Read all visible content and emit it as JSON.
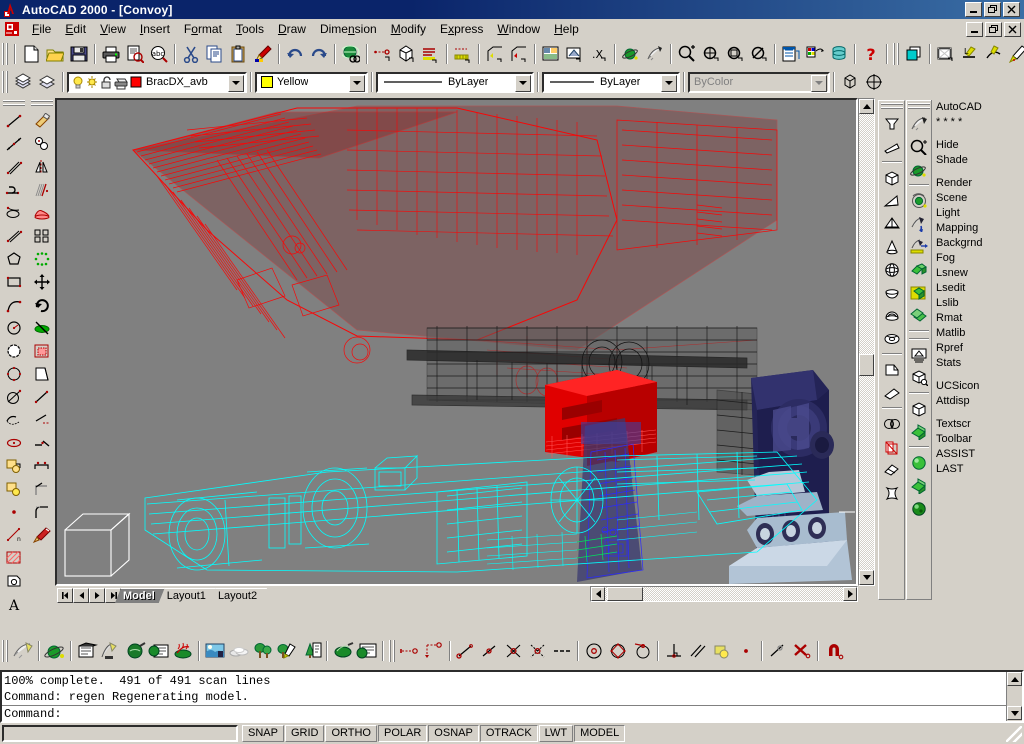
{
  "window": {
    "title": "AutoCAD 2000 - [Convoy]",
    "app_icon": "autocad-icon",
    "minimize": "_",
    "maximize": "❐",
    "close": "✕"
  },
  "menubar": {
    "doc_icon": "document-control-icon",
    "items": [
      {
        "label": "File",
        "accel": "F"
      },
      {
        "label": "Edit",
        "accel": "E"
      },
      {
        "label": "View",
        "accel": "V"
      },
      {
        "label": "Insert",
        "accel": "I"
      },
      {
        "label": "Format",
        "accel": "o"
      },
      {
        "label": "Tools",
        "accel": "T"
      },
      {
        "label": "Draw",
        "accel": "D"
      },
      {
        "label": "Dimension",
        "accel": "n"
      },
      {
        "label": "Modify",
        "accel": "M"
      },
      {
        "label": "Express",
        "accel": "x"
      },
      {
        "label": "Window",
        "accel": "W"
      },
      {
        "label": "Help",
        "accel": "H"
      }
    ],
    "doc_minimize": "_",
    "doc_restore": "❐",
    "doc_close": "✕"
  },
  "standard_toolbar": {
    "buttons": [
      "new-icon",
      "open-icon",
      "save-icon",
      "print-icon",
      "print-preview-icon",
      "find-replace-icon",
      "cut-icon",
      "copy-icon",
      "paste-icon",
      "match-properties-icon",
      "undo-icon",
      "redo-icon",
      "launch-browser-icon",
      "dist-icon",
      "block-icon",
      "list-icon",
      "measure-icon",
      "ucs-icon",
      "ucs-previous-icon",
      "named-views-icon",
      "3d-views-icon",
      "unnamed-icon",
      "shade-icon",
      "render-icon",
      "zoom-realtime-icon",
      "pan-realtime-icon",
      "zoom-window-icon",
      "zoom-previous-icon",
      "properties-icon",
      "designcenter-icon",
      "dbconnect-icon",
      "help-icon"
    ]
  },
  "express_toolbar": {
    "buttons": [
      "color-swatch-icon",
      "layer-manager-icon",
      "text-fit-icon",
      "arc-aligned-text-icon",
      "explode-text-icon",
      "text-mask-icon",
      "rtext-icon"
    ]
  },
  "properties_toolbar": {
    "make_object_layer_icon": "make-object-layer-icon",
    "layer_previous_icon": "layer-previous-icon",
    "layer": {
      "value": "BracDX_avb",
      "icons": [
        "lightbulb-on-icon",
        "freeze-sun-icon",
        "unlock-icon",
        "plot-icon",
        "color-swatch-red-icon"
      ]
    },
    "color": {
      "value": "Yellow",
      "swatch": "#ffff00"
    },
    "linetype": {
      "value": "ByLayer"
    },
    "lineweight": {
      "value": "ByLayer"
    },
    "plotstyle": {
      "value": "ByColor",
      "disabled": true
    },
    "extra_buttons": [
      "inquiry-icon",
      "ucs-target-icon"
    ]
  },
  "draw_toolbar": {
    "name": "Draw",
    "buttons": [
      "line-icon",
      "construction-line-icon",
      "multiline-icon",
      "polyline-icon",
      "polygon-icon",
      "rectangle-icon",
      "arc-icon",
      "circle-icon",
      "revision-cloud-icon",
      "spline-icon",
      "ellipse-icon",
      "ellipse-arc-icon",
      "insert-block-icon",
      "make-block-icon",
      "point-icon",
      "hatch-icon",
      "region-icon",
      "multiline-text-icon"
    ]
  },
  "modify_toolbar": {
    "name": "Modify",
    "buttons": [
      "erase-icon",
      "copy-object-icon",
      "mirror-icon",
      "offset-icon",
      "array-icon",
      "move-icon",
      "rotate-icon",
      "scale-icon",
      "stretch-icon",
      "lengthen-icon",
      "trim-icon",
      "extend-icon",
      "break-at-point-icon",
      "break-icon",
      "chamfer-icon",
      "fillet-icon",
      "explode-icon"
    ]
  },
  "solids_toolbar": {
    "name": "Solids",
    "buttons": [
      "polysolid-icon",
      "wedge-icon",
      "box-icon",
      "cone-pyramid-icon",
      "pyramid-icon",
      "cone-icon",
      "sphere-icon",
      "dish-icon",
      "dome-icon",
      "torus-icon",
      "extrude-icon",
      "revolve-icon",
      "slice-icon",
      "section-icon",
      "interfere-icon",
      "setup-drawing-icon"
    ]
  },
  "render_toolbar": {
    "name": "Render",
    "buttons": [
      "hide-icon",
      "zoom-icon",
      "shade-icon",
      "render-icon",
      "scene-icon",
      "light-icon",
      "materials-icon",
      "materials-library-icon",
      "mapping-icon",
      "render-preferences-icon",
      "statistics-icon",
      "landscape-new-icon",
      "landscape-edit-icon",
      "landscape-library-icon",
      "fog-icon"
    ]
  },
  "screen_menu": {
    "groups": [
      [
        "AutoCAD",
        "* * * *"
      ],
      [
        "Hide",
        "Shade"
      ],
      [
        "Render",
        "Scene",
        "Light",
        "Mapping",
        "Backgrnd",
        "Fog",
        "Lsnew",
        "Lsedit",
        "Lslib",
        "Rmat",
        "Matlib",
        "Rpref",
        "Stats"
      ],
      [
        "UCSicon",
        "Attdisp"
      ],
      [
        "Textscr",
        "Toolbar",
        "ASSIST",
        "LAST"
      ]
    ]
  },
  "render_bottom_toolbar": {
    "buttons": [
      "hide-icon",
      "shade-icon",
      "render-icon",
      "scene-icon",
      "light-icon",
      "materials-icon",
      "materials-library-icon",
      "mapping-icon",
      "background-icon",
      "fog-icon",
      "landscape-new-icon",
      "landscape-edit-icon",
      "landscape-library-icon",
      "render-preferences-icon",
      "statistics-icon"
    ]
  },
  "osnap_toolbar": {
    "buttons": [
      "snap-from-icon",
      "snap-tracking-icon",
      "snap-endpoint-icon",
      "snap-midpoint-icon",
      "snap-intersection-icon",
      "snap-apparent-intersection-icon",
      "snap-extension-icon",
      "snap-center-icon",
      "snap-quadrant-icon",
      "snap-tangent-icon",
      "snap-perpendicular-icon",
      "snap-parallel-icon",
      "snap-insert-icon",
      "snap-node-icon",
      "snap-nearest-icon",
      "snap-none-icon",
      "osnap-settings-icon"
    ]
  },
  "drawing": {
    "name": "Convoy",
    "background_color": "#808080",
    "ucs_icon": "ucs-box-icon",
    "objects": [
      {
        "name": "trailer-cab-red-wireframe",
        "color": "#ff0000"
      },
      {
        "name": "chassis-black-wireframe",
        "color": "#202020"
      },
      {
        "name": "gantry-beam-red-solid",
        "color": "#dd0b0b"
      },
      {
        "name": "tower-navy-solid",
        "color": "#2a2a68"
      },
      {
        "name": "base-lightblue-solid",
        "color": "#a8bcd0"
      },
      {
        "name": "lower-vehicle-cyan-wireframe",
        "color": "#00ffff"
      }
    ]
  },
  "tabs": {
    "nav": [
      "first-tab-icon",
      "previous-tab-icon",
      "next-tab-icon",
      "last-tab-icon"
    ],
    "items": [
      {
        "label": "Model",
        "active": true
      },
      {
        "label": "Layout1",
        "active": false
      },
      {
        "label": "Layout2",
        "active": false
      }
    ]
  },
  "command_window": {
    "lines": [
      "100% complete.  491 of 491 scan lines",
      "Command: regen Regenerating model."
    ],
    "prompt": "Command:"
  },
  "statusbar": {
    "coordinates": "",
    "toggles": [
      {
        "label": "SNAP",
        "pressed": false
      },
      {
        "label": "GRID",
        "pressed": false
      },
      {
        "label": "ORTHO",
        "pressed": false
      },
      {
        "label": "POLAR",
        "pressed": true
      },
      {
        "label": "OSNAP",
        "pressed": true
      },
      {
        "label": "OTRACK",
        "pressed": true
      },
      {
        "label": "LWT",
        "pressed": false
      },
      {
        "label": "MODEL",
        "pressed": true
      }
    ]
  },
  "colors": {
    "face": "#d4d0c8",
    "title_start": "#0a246a",
    "title_end": "#3a6ea5",
    "canvas": "#808080",
    "highlight": "#ffffff",
    "shadow": "#808080",
    "dark_shadow": "#404040"
  }
}
